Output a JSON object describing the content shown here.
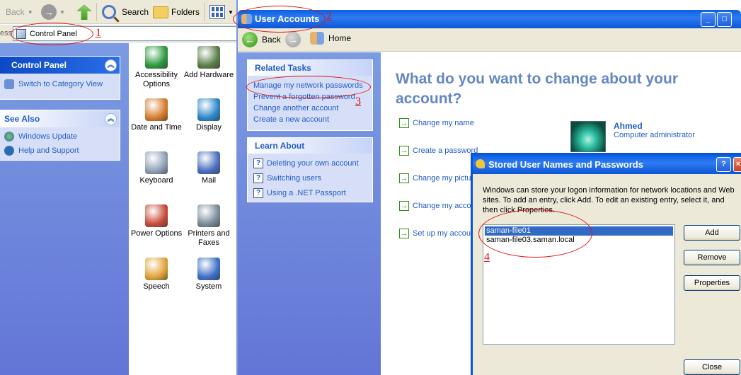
{
  "control_panel": {
    "toolbar": {
      "back_label": "Back",
      "search_label": "Search",
      "folders_label": "Folders"
    },
    "address": {
      "label_fragment": "ess",
      "value": "Control Panel"
    },
    "sidebar": {
      "control_panel_header": "Control Panel",
      "switch_view_link": "Switch to Category View",
      "see_also_header": "See Also",
      "see_also_items": [
        "Windows Update",
        "Help and Support"
      ]
    },
    "icons": [
      {
        "label": "Accessibility Options",
        "color": "#2b9a3c"
      },
      {
        "label": "Add Hardware",
        "color": "#5a7f4a"
      },
      {
        "label": "Date and Time",
        "color": "#d87b2c"
      },
      {
        "label": "Display",
        "color": "#2c86c9"
      },
      {
        "label": "Keyboard",
        "color": "#8fa1b8"
      },
      {
        "label": "Mail",
        "color": "#4b6fc0"
      },
      {
        "label": "Power Options",
        "color": "#c94a3a"
      },
      {
        "label": "Printers and Faxes",
        "color": "#7a8c9a"
      },
      {
        "label": "Speech",
        "color": "#e0a338"
      },
      {
        "label": "System",
        "color": "#3d6fc8"
      }
    ]
  },
  "user_accounts": {
    "title": "User Accounts",
    "nav": {
      "back_label": "Back",
      "home_label": "Home"
    },
    "related_tasks": {
      "header": "Related Tasks",
      "links": [
        "Manage my network passwords",
        "Prevent a forgotten password",
        "Change another account",
        "Create a new account"
      ]
    },
    "learn_about": {
      "header": "Learn About",
      "links": [
        "Deleting your own account",
        "Switching users",
        "Using a .NET Passport"
      ]
    },
    "heading": "What do you want to change about your account?",
    "tasks": [
      "Change my name",
      "Create a password",
      "Change my pictur",
      "Change my accou",
      "Set up my accoun"
    ],
    "user": {
      "name": "Ahmed",
      "role": "Computer administrator"
    }
  },
  "dialog": {
    "title": "Stored User Names and Passwords",
    "description": "Windows can store your logon information for network locations and Web sites. To add an entry, click Add. To edit an existing entry, select it, and then click Properties.",
    "entries": [
      "saman-file01",
      "saman-file03.saman.local"
    ],
    "buttons": {
      "add": "Add",
      "remove": "Remove",
      "properties": "Properties",
      "close": "Close"
    }
  },
  "annotations": {
    "n1": "1",
    "n2": "2",
    "n3": "3",
    "n4": "4",
    "color": "#e01010"
  },
  "colors": {
    "xp_blue_title": "#0a5fe3",
    "task_pane_blue": "#7b9be3",
    "link_blue": "#215dc6",
    "heading_blue": "#6487c4",
    "selection_blue": "#316ac5"
  }
}
